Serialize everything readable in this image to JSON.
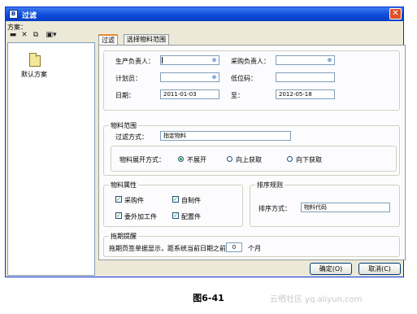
{
  "window": {
    "title": "过滤",
    "close_label": "✕",
    "app_icon_label": "B"
  },
  "left": {
    "scheme_label": "方案：",
    "scheme_items": [
      "默认方案"
    ]
  },
  "toolbar": {
    "save": "▬",
    "delete": "✕",
    "copy": "⧉",
    "more": "▣▾"
  },
  "tabs": [
    "过滤",
    "选择物料范围"
  ],
  "filter": {
    "producer_label": "生产负责人：",
    "producer_value": "",
    "purchaser_label": "采购负责人：",
    "purchaser_value": "",
    "planner_label": "计划员：",
    "planner_value": "",
    "lowcode_label": "低位码：",
    "lowcode_value": "",
    "date_label": "日期：",
    "date_from": "2011-01-03",
    "to_label": "至：",
    "date_to": "2012-05-18"
  },
  "material_range": {
    "title": "物料范围",
    "method_label": "过滤方式：",
    "method_value": "指定物料",
    "expand_label": "物料展开方式：",
    "options": [
      "不展开",
      "向上获取",
      "向下获取"
    ],
    "selected": 0
  },
  "attributes": {
    "title": "物料属性",
    "items": [
      {
        "label": "采购件",
        "checked": true
      },
      {
        "label": "自制件",
        "checked": true
      },
      {
        "label": "委外加工件",
        "checked": true
      },
      {
        "label": "配置件",
        "checked": true
      }
    ]
  },
  "sort": {
    "title": "排序规则",
    "label": "排序方式：",
    "value": "物料代码"
  },
  "overdue": {
    "title": "拖期提醒",
    "text": "拖期页签单据显示，距系统当前日期之前",
    "months_value": "0",
    "unit": "个月"
  },
  "buttons": {
    "ok": "确定(O)",
    "cancel": "取消(C)"
  },
  "caption": "图6-41",
  "watermark": "云栖社区 yq.aliyun.com",
  "colors": {
    "title_bar": "#0a4ad6",
    "close": "#e0502a",
    "tab_accent": "#e68b2c",
    "check": "#21a121"
  },
  "icons": {
    "lookup": "lookup-icon",
    "folder": "folder-icon"
  }
}
